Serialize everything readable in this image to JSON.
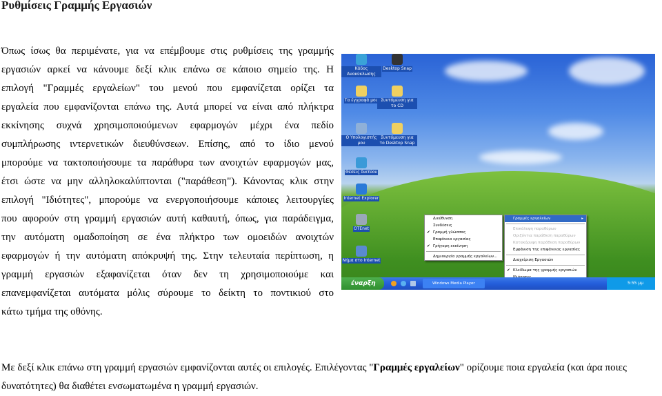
{
  "title": "Ρυθμίσεις Γραμμής Εργασιών",
  "paragraph_lines": [
    "Όπως ίσως θα περιμένατε, για να επέμβουμε στις ρυθμίσεις της γραμμής",
    "εργασιών αρκεί να κάνουμε δεξί κλικ επάνω σε κάποιο σημείο της. Η",
    "επιλογή \"Γραμμές εργαλείων\" του μενού που εμφανίζεται ορίζει τα",
    "εργαλεία που εμφανίζονται επάνω της. Αυτά μπορεί να είναι από πλήκτρα",
    "εκκίνησης συχνά χρησιμοποιούμενων εφαρμογών μέχρι ένα πεδίο",
    "συμπλήρωσης ιντερνετικών διευθύνσεων. Επίσης, από το ίδιο μενού",
    "μπορούμε να τακτοποιήσουμε τα παράθυρα των ανοιχτών εφαρμογών μας,",
    "έτσι ώστε να μην αλληλοκαλύπτονται (\"παράθεση\"). Κάνοντας κλικ στην",
    "επιλογή \"Ιδιότητες\", μπορούμε να ενεργοποιήσουμε κάποιες λειτουργίες",
    "που αφορούν στη γραμμή εργασιών αυτή καθαυτή, όπως, για παράδειγμα,",
    "την αυτόματη ομαδοποίηση σε ένα πλήκτρο των ομοειδών ανοιχτών",
    "εφαρμογών ή την αυτόματη απόκρυψή της. Στην τελευταία περίπτωση, η",
    "γραμμή εργασιών εξαφανίζεται όταν δεν τη χρησιμοποιούμε και",
    "επανεμφανίζεται αυτόματα μόλις σύρουμε το δείκτη το ποντικιού στο",
    "κάτω τμήμα της οθόνης."
  ],
  "caption": {
    "before": "Με δεξί κλικ επάνω στη γραμμή εργασιών εμφανίζονται αυτές οι επιλογές. Επιλέγοντας \"",
    "bold": "Γραμμές εργαλείων",
    "after": "\" ορίζουμε ποια εργαλεία (και άρα ποιες δυνατότητες) θα διαθέτει ενσωματωμένα η γραμμή εργασιών."
  },
  "screenshot": {
    "desktop_icons": [
      {
        "label": "Κάδος Ανακύκλωσης",
        "color": "#3aa3d8"
      },
      {
        "label": "Desktop Snap",
        "color": "#333333"
      },
      {
        "label": "Τα έγγραφά μου",
        "color": "#f0d060"
      },
      {
        "label": "Συντόμευση για το CD",
        "color": "#f0d060"
      },
      {
        "label": "Ο Υπολογιστής μου",
        "color": "#8fb0d8"
      },
      {
        "label": "Συντόμευση για το Desktop Snap",
        "color": "#f0d060"
      },
      {
        "label": "Θέσεις δικτύου",
        "color": "#3a9ad8"
      },
      {
        "label": "Internet Explorer",
        "color": "#2a7ad8"
      },
      {
        "label": "OTEnet",
        "color": "#9aa8b8"
      },
      {
        "label": "Νήμα στο Internet",
        "color": "#5a8ad0"
      }
    ],
    "toolbars_menu": [
      {
        "label": "Διεύθυνση",
        "checked": false
      },
      {
        "label": "Συνδέσεις",
        "checked": false
      },
      {
        "label": "Γραμμή γλώσσας",
        "checked": true
      },
      {
        "label": "Επιφάνεια εργασίας",
        "checked": false
      },
      {
        "label": "Γρήγορη εκκίνηση",
        "checked": true
      },
      {
        "label": "Δημιουργία γραμμής εργαλείων...",
        "checked": false
      }
    ],
    "context_menu": {
      "submenu": "Γραμμές εργαλείων",
      "arrange": [
        "Επικάλυψη παραθύρων",
        "Οριζόντια παράθεση παραθύρων",
        "Κατακόρυφη παράθεση παραθύρων"
      ],
      "show_desktop": "Εμφάνιση της επιφάνειας εργασίας",
      "task_manager": "Διαχείριση Εργασιών",
      "lock": "Κλείδωμα της γραμμής εργασιών",
      "properties": "Ιδιότητες"
    },
    "taskbar": {
      "start": "έναρξη",
      "task": "Windows Media Player",
      "lang": "EN",
      "clock": "5:55 μμ"
    }
  }
}
